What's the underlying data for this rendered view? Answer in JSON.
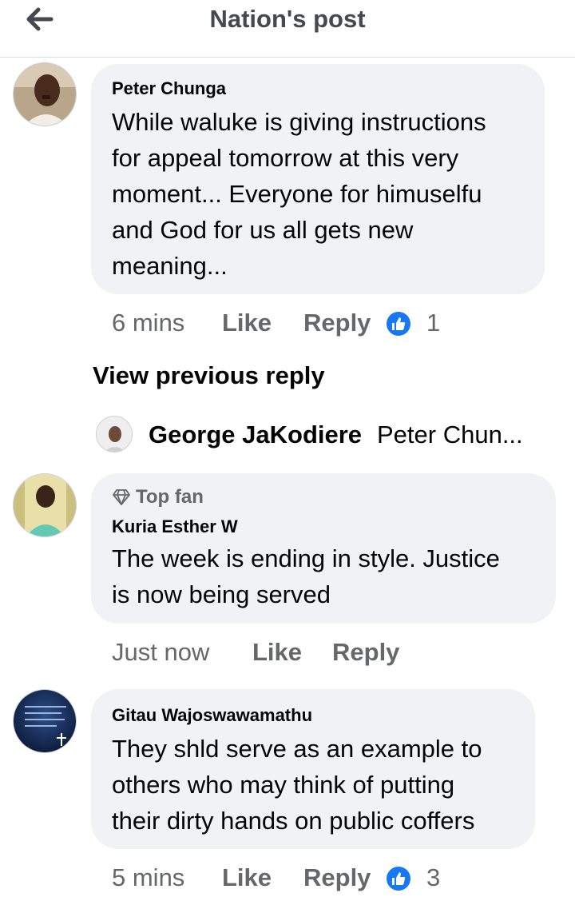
{
  "header": {
    "title": "Nation's post"
  },
  "comments": [
    {
      "author": "Peter Chunga",
      "lines": [
        "While waluke is giving instructions",
        "for appeal tomorrow at this very",
        "moment... Everyone for himuselfu",
        "and God for us all gets new",
        "meaning..."
      ],
      "time": "6 mins",
      "like_label": "Like",
      "reply_label": "Reply",
      "reaction_count": "1"
    },
    {
      "badge": "Top fan",
      "author": "Kuria Esther W",
      "lines": [
        "The week is ending in style. Justice",
        "is now being served"
      ],
      "time": "Just now",
      "like_label": "Like",
      "reply_label": "Reply"
    },
    {
      "author": "Gitau Wajoswawamathu",
      "lines": [
        "They shld serve as an example to",
        "others who may think of putting",
        "their dirty hands on public coffers"
      ],
      "time": "5 mins",
      "like_label": "Like",
      "reply_label": "Reply",
      "reaction_count": "3"
    }
  ],
  "replies": {
    "view_previous_label": "View previous reply",
    "preview_author": "George JaKodiere",
    "preview_text": "Peter Chun..."
  },
  "colors": {
    "like_blue": "#1877f2",
    "bubble_bg": "#f0f2f5",
    "meta_gray": "#65676b"
  },
  "icons": [
    "back-arrow-icon",
    "thumbs-up-icon",
    "diamond-icon"
  ]
}
